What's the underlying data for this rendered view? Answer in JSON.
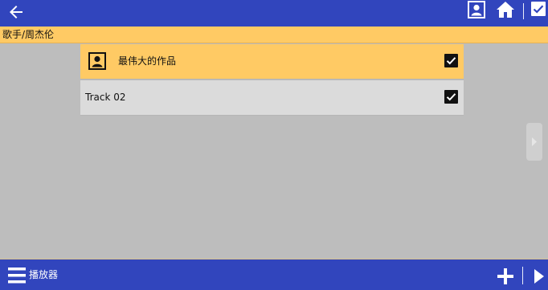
{
  "header": {
    "back_icon": "arrow-left-icon",
    "contact_icon": "contact-card-icon",
    "home_icon": "home-icon",
    "select_all_icon": "checkbox-checked-icon"
  },
  "breadcrumb": {
    "text": "歌手/周杰伦"
  },
  "list": {
    "items": [
      {
        "label": "最伟大的作品",
        "icon": "contact-card-icon",
        "checked": true,
        "highlighted": true
      },
      {
        "label": "Track 02",
        "checked": true,
        "highlighted": false
      }
    ]
  },
  "side_handle": {
    "icon": "chevron-right-icon"
  },
  "footer": {
    "menu_icon": "menu-icon",
    "player_label": "播放器",
    "add_icon": "plus-icon",
    "play_icon": "play-icon"
  },
  "colors": {
    "bar_blue": "#3145bd",
    "highlight_orange": "#ffca64",
    "background_gray": "#bdbdbd",
    "row_gray": "#dbdbdb"
  }
}
